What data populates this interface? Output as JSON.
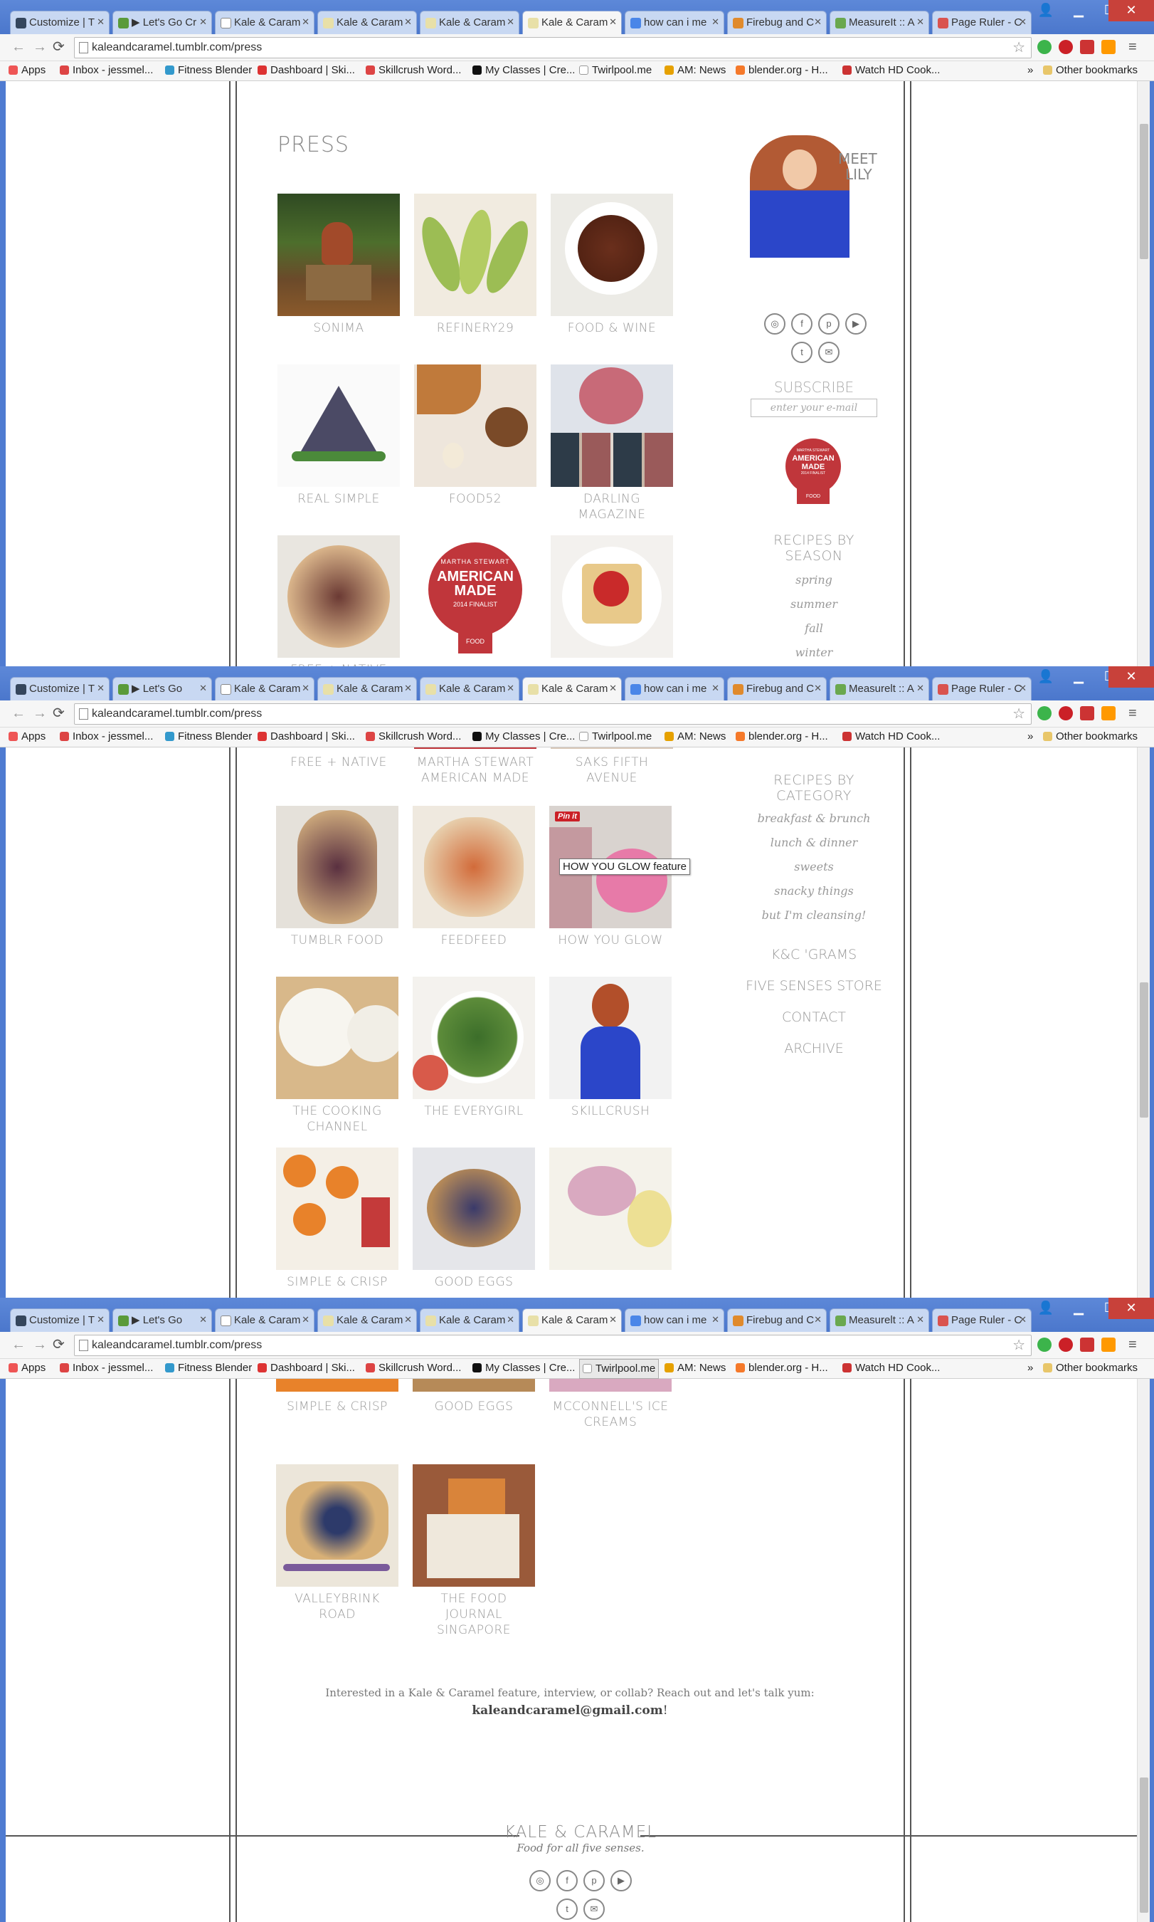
{
  "browser": {
    "tabs": [
      {
        "label": "Customize | T",
        "favicon": "tumblr"
      },
      {
        "label": "▶ Let's Go Cr",
        "favicon": "green"
      },
      {
        "label": "Kale & Caram",
        "favicon": "page"
      },
      {
        "label": "Kale & Caram",
        "favicon": "kc"
      },
      {
        "label": "Kale & Caram",
        "favicon": "kc"
      },
      {
        "label": "Kale & Caram",
        "favicon": "kc",
        "active": true
      },
      {
        "label": "how can i me",
        "favicon": "google"
      },
      {
        "label": "Firebug and C",
        "favicon": "firebug"
      },
      {
        "label": "MeasureIt :: A",
        "favicon": "measureit"
      },
      {
        "label": "Page Ruler - C",
        "favicon": "ruler"
      }
    ],
    "tabs_short": [
      "Customize | T",
      "▶ Let's Go",
      "Kale & Caram",
      "Kale & Caram",
      "Kale & Caram",
      "Kale & Caram",
      "how can i me",
      "Firebug and C",
      "Measurelt :: A",
      "Page Ruler - C"
    ],
    "url": "kaleandcaramel.tumblr.com/press",
    "bookmarks": [
      "Apps",
      "Inbox - jessmel...",
      "Fitness Blender",
      "Dashboard | Ski...",
      "Skillcrush Word...",
      "My Classes | Cre...",
      "Twirlpool.me",
      "AM: News",
      "blender.org - H...",
      "Watch HD Cook..."
    ],
    "more": "»",
    "other_bookmarks": "Other bookmarks"
  },
  "page": {
    "title": "PRESS",
    "press_items": [
      {
        "caption": "SONIMA"
      },
      {
        "caption": "REFINERY29"
      },
      {
        "caption": "FOOD & WINE"
      },
      {
        "caption": "REAL SIMPLE"
      },
      {
        "caption": "FOOD52"
      },
      {
        "caption": "DARLING MAGAZINE"
      },
      {
        "caption": "FREE + NATIVE"
      },
      {
        "caption": "MARTHA STEWART AMERICAN MADE"
      },
      {
        "caption": "SAKS FIFTH AVENUE"
      },
      {
        "caption": "TUMBLR FOOD"
      },
      {
        "caption": "FEEDFEED"
      },
      {
        "caption": "HOW YOU GLOW"
      },
      {
        "caption": "THE COOKING CHANNEL"
      },
      {
        "caption": "THE EVERYGIRL"
      },
      {
        "caption": "SKILLCRUSH"
      },
      {
        "caption": "SIMPLE & CRISP"
      },
      {
        "caption": "GOOD EGGS"
      },
      {
        "caption": "MCCONNELL'S ICE CREAMS"
      },
      {
        "caption": "VALLEYBRINK ROAD"
      },
      {
        "caption": "THE FOOD JOURNAL SINGAPORE"
      }
    ],
    "tooltip": "HOW YOU GLOW feature",
    "pin_it": "Pin it",
    "contact_text": "Interested in a Kale & Caramel feature, interview, or collab? Reach out and let's talk yum:",
    "contact_email": "kaleandcaramel@gmail.com",
    "contact_after": "!"
  },
  "sidebar": {
    "meet_line1": "MEET",
    "meet_line2": "LILY",
    "subscribe": "SUBSCRIBE",
    "email_placeholder": "enter your e-mail",
    "badge_top": "MARTHA STEWART",
    "badge_main1": "AMERICAN",
    "badge_main2": "MADE",
    "badge_sub": "2014 FINALIST",
    "badge_cat": "FOOD",
    "recipes_by_season": "RECIPES BY SEASON",
    "seasons": [
      "spring",
      "summer",
      "fall",
      "winter"
    ],
    "recipes_by_category": "RECIPES BY CATEGORY",
    "categories": [
      "breakfast & brunch",
      "lunch & dinner",
      "sweets",
      "snacky things",
      "but I'm cleansing!"
    ],
    "links": [
      "K&C 'GRAMS",
      "FIVE SENSES STORE",
      "CONTACT",
      "ARCHIVE"
    ],
    "social_icons": [
      "instagram-icon",
      "facebook-icon",
      "pinterest-icon",
      "youtube-icon",
      "twitter-icon",
      "email-icon"
    ]
  },
  "footer": {
    "brand": "KALE & CARAMEL",
    "tagline": "Food for all five senses."
  },
  "colors": {
    "chrome_blue": "#4f7bd1",
    "seal_red": "#c0363b",
    "text_gray": "#999999"
  }
}
